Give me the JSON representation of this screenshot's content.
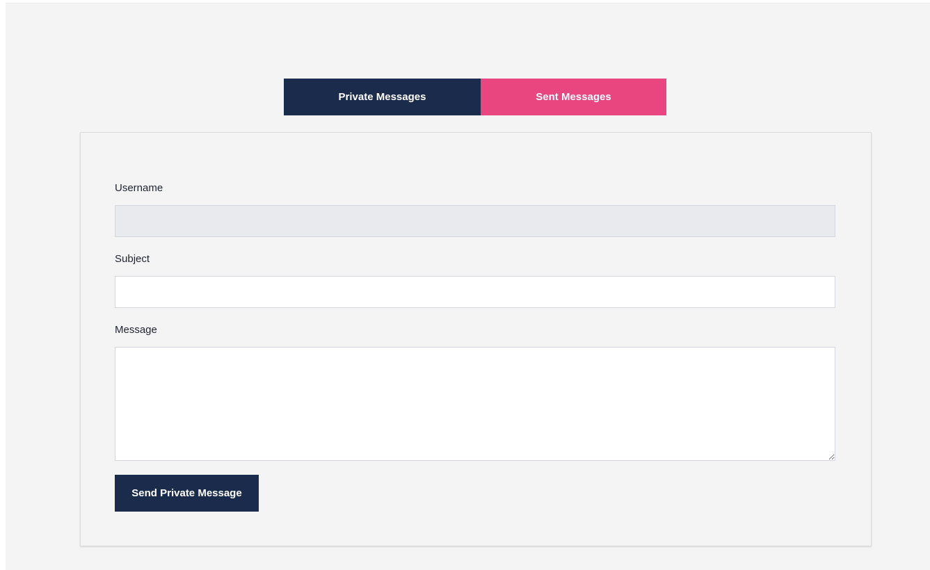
{
  "tabs": {
    "private_label": "Private Messages",
    "sent_label": "Sent Messages",
    "colors": {
      "private": "#1a2b4c",
      "sent": "#e9467f"
    }
  },
  "form": {
    "username": {
      "label": "Username",
      "value": "",
      "readonly": true
    },
    "subject": {
      "label": "Subject",
      "value": "",
      "placeholder": ""
    },
    "message": {
      "label": "Message",
      "value": "",
      "placeholder": ""
    },
    "submit_label": "Send Private Message"
  }
}
